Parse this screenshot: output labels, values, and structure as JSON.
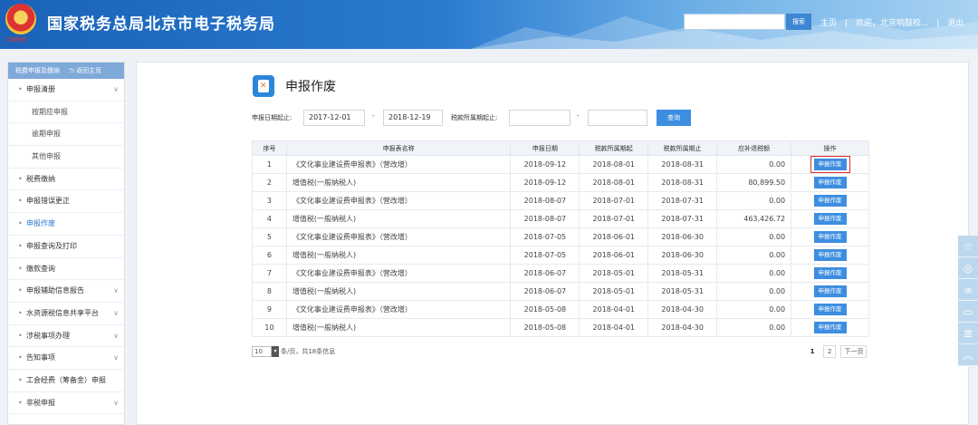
{
  "header": {
    "emblem_text": "中国税务",
    "title": "国家税务总局北京市电子税务局",
    "search_placeholder": "",
    "search_button": "搜索",
    "home_link": "主页",
    "welcome": "欢迎，北京响鼓校...",
    "separator": "|",
    "logout": "退出"
  },
  "sidebar": {
    "head": "税费申报及缴纳",
    "back": "返回主页",
    "items": [
      {
        "label": "申报清册",
        "chev": "∨"
      },
      {
        "label": "按期应申报"
      },
      {
        "label": "逾期申报"
      },
      {
        "label": "其他申报"
      },
      {
        "label": "税费缴纳"
      },
      {
        "label": "申报错误更正"
      },
      {
        "label": "申报作废"
      },
      {
        "label": "申报查询及打印"
      },
      {
        "label": "缴款查询"
      },
      {
        "label": "申报辅助信息报告",
        "chev": "∨"
      },
      {
        "label": "水资源税信息共享平台",
        "chev": "∨"
      },
      {
        "label": "涉税事项办理",
        "chev": "∨"
      },
      {
        "label": "告知事项",
        "chev": "∨"
      },
      {
        "label": "工会经费（筹备金）申报"
      },
      {
        "label": "非税申报",
        "chev": "∨"
      }
    ]
  },
  "main": {
    "title": "申报作废",
    "filter": {
      "date_label": "申报日期起止:",
      "date_from": "2017-12-01",
      "date_to": "2018-12-19",
      "period_label": "税款所属期起止:",
      "period_from": "",
      "period_to": "",
      "dash": "-",
      "query_button": "查询"
    },
    "table": {
      "headers": [
        "序号",
        "申报表名称",
        "申报日期",
        "税款所属期起",
        "税款所属期止",
        "应补退税额",
        "操作"
      ],
      "rows": [
        {
          "no": "1",
          "name": "《文化事业建设费申报表》（营改增）",
          "date": "2018-09-12",
          "start": "2018-08-01",
          "end": "2018-08-31",
          "amount": "0.00",
          "op": "申报作废"
        },
        {
          "no": "2",
          "name": "增值税(一般纳税人)",
          "date": "2018-09-12",
          "start": "2018-08-01",
          "end": "2018-08-31",
          "amount": "80,899.50",
          "op": "申报作废"
        },
        {
          "no": "3",
          "name": "《文化事业建设费申报表》（营改增）",
          "date": "2018-08-07",
          "start": "2018-07-01",
          "end": "2018-07-31",
          "amount": "0.00",
          "op": "申报作废"
        },
        {
          "no": "4",
          "name": "增值税(一般纳税人)",
          "date": "2018-08-07",
          "start": "2018-07-01",
          "end": "2018-07-31",
          "amount": "463,426.72",
          "op": "申报作废"
        },
        {
          "no": "5",
          "name": "《文化事业建设费申报表》（营改增）",
          "date": "2018-07-05",
          "start": "2018-06-01",
          "end": "2018-06-30",
          "amount": "0.00",
          "op": "申报作废"
        },
        {
          "no": "6",
          "name": "增值税(一般纳税人)",
          "date": "2018-07-05",
          "start": "2018-06-01",
          "end": "2018-06-30",
          "amount": "0.00",
          "op": "申报作废"
        },
        {
          "no": "7",
          "name": "《文化事业建设费申报表》（营改增）",
          "date": "2018-06-07",
          "start": "2018-05-01",
          "end": "2018-05-31",
          "amount": "0.00",
          "op": "申报作废"
        },
        {
          "no": "8",
          "name": "增值税(一般纳税人)",
          "date": "2018-06-07",
          "start": "2018-05-01",
          "end": "2018-05-31",
          "amount": "0.00",
          "op": "申报作废"
        },
        {
          "no": "9",
          "name": "《文化事业建设费申报表》（营改增）",
          "date": "2018-05-08",
          "start": "2018-04-01",
          "end": "2018-04-30",
          "amount": "0.00",
          "op": "申报作废"
        },
        {
          "no": "10",
          "name": "增值税(一般纳税人)",
          "date": "2018-05-08",
          "start": "2018-04-01",
          "end": "2018-04-30",
          "amount": "0.00",
          "op": "申报作废"
        }
      ]
    },
    "pager": {
      "page_size": "10",
      "summary": "条/页，共18条信息",
      "pages": [
        "1",
        "2"
      ],
      "next": "下一页"
    }
  },
  "float_bar": [
    "star-icon",
    "chat-icon",
    "link-icon",
    "message-icon",
    "document-icon",
    "up-arrow-icon"
  ],
  "colors": {
    "header_blue": "#1a63b8",
    "accent": "#3d8ee0",
    "highlight": "#d9302a"
  }
}
